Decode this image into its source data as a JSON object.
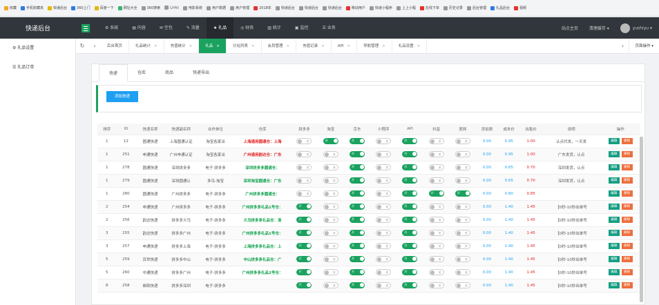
{
  "bookmarks": [
    "收藏",
    "手机收藏夹",
    "快递后台",
    "360上门",
    "百度一下",
    "网址大全",
    "360搜索",
    "Links",
    "电影系统",
    "用户数据",
    "用户管理",
    "2018年",
    "快递后台",
    "快递后台",
    "快递后台",
    "移动用户",
    "快递小程序",
    "上上小程",
    "在线下单",
    "历史记录",
    "后台管理",
    "礼品后台",
    "视频"
  ],
  "header": {
    "logo": "快递后台",
    "nav": [
      "系统",
      "内容",
      "空包",
      "流量",
      "礼品",
      "财务",
      "统计",
      "监控",
      "业务"
    ],
    "active": "礼品",
    "right": {
      "home": "站点主页",
      "cache": "清理缓存",
      "user": "yushiyu"
    }
  },
  "sidebar": [
    "礼品设置",
    "礼品订单"
  ],
  "tabs": [
    "后台首页",
    "礼品统计",
    "充值统计",
    "礼品",
    "分站列表",
    "会员管理",
    "充值记录",
    "API",
    "导航管理",
    "礼品设置"
  ],
  "active_tab": "礼品",
  "page_ops": "页面操作",
  "subtabs": [
    "快递",
    "仓库",
    "商品",
    "快递导出"
  ],
  "add_button": "添加快递",
  "table": {
    "headers": [
      "排序",
      "ID",
      "快递名称",
      "快递副名称",
      "合作单位",
      "仓库",
      "拼多多",
      "淘宝",
      "京东",
      "小程序",
      "API",
      "抖音",
      "爱网",
      "添加费",
      "成本价",
      "出售价",
      "说明",
      "操作"
    ],
    "toggle_on": "开",
    "toggle_off": "关",
    "edit": "编辑",
    "del": "删除",
    "rows": [
      {
        "c": [
          "1",
          "12",
          "圆通快递",
          "上海圆通认证",
          "淘宝各家派"
        ],
        "wh": "上海通用圆通仓：上海",
        "wc": "red",
        "t": [
          0,
          1,
          1,
          0,
          1,
          0,
          0
        ],
        "f": [
          "0.00",
          "0.95",
          "1.00"
        ],
        "n": "认点代发，一天发"
      },
      {
        "c": [
          "1",
          "251",
          "申通快递",
          "广州申通认证",
          "淘宝各家派"
        ],
        "wh": "广州通用韵达仓：广东",
        "wc": "red",
        "t": [
          0,
          0,
          1,
          0,
          1,
          0,
          0
        ],
        "f": [
          "0.00",
          "0.95",
          "1.00"
        ],
        "n": "广东发货，认点"
      },
      {
        "c": [
          "1",
          "278",
          "圆通快递",
          "深圳拼多多",
          "电子-拼多多"
        ],
        "wh": "深圳拼多多圆通仓：",
        "wc": "grn",
        "t": [
          0,
          0,
          1,
          0,
          1,
          0,
          0
        ],
        "f": [
          "0.00",
          "0.65",
          "0.70"
        ],
        "n": "深圳发货，认点"
      },
      {
        "c": [
          "1",
          "279",
          "圆通快递",
          "深圳圆通认",
          "多鸟-淘宝"
        ],
        "wh": "深圳淘宝圆通仓：广东",
        "wc": "grn",
        "t": [
          0,
          0,
          1,
          0,
          1,
          0,
          0
        ],
        "f": [
          "0.00",
          "0.65",
          "0.70"
        ],
        "n": "深圳发货，认点"
      },
      {
        "c": [
          "1",
          "280",
          "圆通快递",
          "广州拼多多",
          "电子-拼多多"
        ],
        "wh": "广州拼多多圆通仓：",
        "wc": "grn",
        "t": [
          0,
          0,
          1,
          0,
          1,
          1,
          1
        ],
        "f": [
          "0.00",
          "0.80",
          "0.85"
        ],
        "n": ""
      },
      {
        "c": [
          "2",
          "254",
          "申通快递",
          "广州拼多多",
          "电子-拼多多"
        ],
        "wh": "广州拼多多礼品1号仓：",
        "wc": "grn",
        "t": [
          1,
          0,
          1,
          0,
          1,
          0,
          0
        ],
        "f": [
          "0.00",
          "1.40",
          "1.45"
        ],
        "n": "【0秒-10秒出单号"
      },
      {
        "c": [
          "2",
          "256",
          "韵达快递",
          "拼多多义乌",
          "电子-拼多多"
        ],
        "wh": "义乌拼多多礼品仓：浙",
        "wc": "grn",
        "t": [
          1,
          0,
          1,
          0,
          1,
          0,
          0
        ],
        "f": [
          "0.00",
          "1.40",
          "1.45"
        ],
        "n": "【0秒-10秒出单号"
      },
      {
        "c": [
          "3",
          "255",
          "韵达快递",
          "拼多多广州",
          "电子-拼多多"
        ],
        "wh": "广州拼多多礼品1号仓：",
        "wc": "grn",
        "t": [
          1,
          0,
          1,
          0,
          1,
          0,
          0
        ],
        "f": [
          "0.00",
          "1.40",
          "1.45"
        ],
        "n": "【0秒-10秒出单号"
      },
      {
        "c": [
          "3",
          "257",
          "申通快递",
          "拼多多上海",
          "电子-拼多多"
        ],
        "wh": "上海拼多多礼品仓：上",
        "wc": "grn",
        "t": [
          1,
          0,
          1,
          0,
          1,
          0,
          0
        ],
        "f": [
          "0.00",
          "1.40",
          "1.45"
        ],
        "n": "【0秒-10秒出单号"
      },
      {
        "c": [
          "5",
          "259",
          "百世快递",
          "拼多多中山",
          "电子-拼多多"
        ],
        "wh": "中山拼多多礼品仓：广",
        "wc": "grn",
        "t": [
          1,
          0,
          1,
          0,
          1,
          0,
          0
        ],
        "f": [
          "0.00",
          "1.40",
          "1.45"
        ],
        "n": "【0秒-10秒出单号"
      },
      {
        "c": [
          "5",
          "260",
          "中通快递",
          "拼多多广州",
          "电子-拼多多"
        ],
        "wh": "广州拼多多礼品2号仓：",
        "wc": "grn",
        "t": [
          1,
          0,
          1,
          0,
          1,
          0,
          0
        ],
        "f": [
          "0.00",
          "1.40",
          "1.45"
        ],
        "n": "【0秒-10秒出单号"
      },
      {
        "c": [
          "8",
          "258",
          "邮政快递",
          "拼多多深圳",
          "电子-拼多多"
        ],
        "wh": "",
        "wc": "grn",
        "t": [
          1,
          0,
          1,
          0,
          1,
          0,
          0
        ],
        "f": [
          "0.00",
          "1.40",
          "1.45"
        ],
        "n": "【0秒-10秒出单号"
      }
    ]
  }
}
